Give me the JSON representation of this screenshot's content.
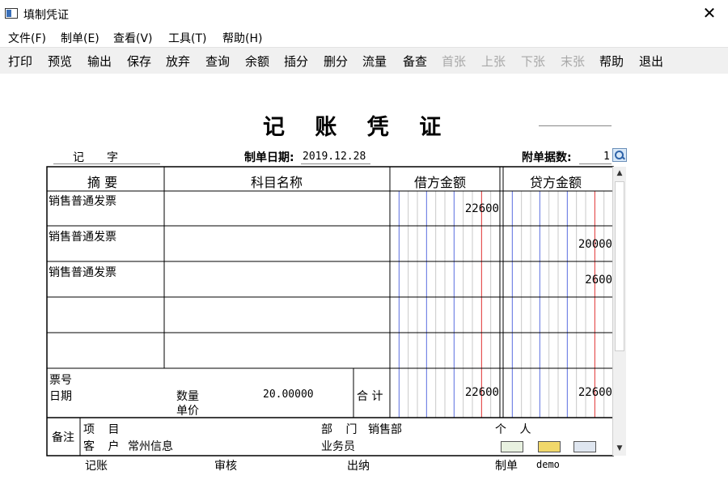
{
  "window": {
    "title": "填制凭证"
  },
  "menu": [
    "文件(F)",
    "制单(E)",
    "查看(V)",
    "工具(T)",
    "帮助(H)"
  ],
  "toolbar": {
    "buttons": [
      {
        "label": "打印",
        "enabled": true
      },
      {
        "label": "预览",
        "enabled": true
      },
      {
        "label": "输出",
        "enabled": true
      },
      {
        "label": "保存",
        "enabled": true
      },
      {
        "label": "放弃",
        "enabled": true
      },
      {
        "label": "查询",
        "enabled": true
      },
      {
        "label": "余额",
        "enabled": true
      },
      {
        "label": "插分",
        "enabled": true
      },
      {
        "label": "删分",
        "enabled": true
      },
      {
        "label": "流量",
        "enabled": true
      },
      {
        "label": "备查",
        "enabled": true
      },
      {
        "label": "首张",
        "enabled": false
      },
      {
        "label": "上张",
        "enabled": false
      },
      {
        "label": "下张",
        "enabled": false
      },
      {
        "label": "末张",
        "enabled": false
      },
      {
        "label": "帮助",
        "enabled": true
      },
      {
        "label": "退出",
        "enabled": true
      }
    ]
  },
  "voucher": {
    "title": "记 账 凭 证",
    "type_label": "记",
    "type_suffix": "字",
    "date_label": "制单日期:",
    "date_value": "2019.12.28",
    "attach_label": "附单据数:",
    "attach_value": "1",
    "columns": {
      "summary": "摘 要",
      "account": "科目名称",
      "debit": "借方金额",
      "credit": "贷方金额"
    },
    "rows": [
      {
        "summary": "销售普通发票",
        "account": "",
        "debit": "22600",
        "credit": ""
      },
      {
        "summary": "销售普通发票",
        "account": "",
        "debit": "",
        "credit": "20000"
      },
      {
        "summary": "销售普通发票",
        "account": "",
        "debit": "",
        "credit": "2600"
      },
      {
        "summary": "",
        "account": "",
        "debit": "",
        "credit": ""
      },
      {
        "summary": "",
        "account": "",
        "debit": "",
        "credit": ""
      }
    ],
    "footer": {
      "ticket_no_label": "票号",
      "date_label": "日期",
      "quantity_label": "数量",
      "quantity_value": "20.00000",
      "unit_price_label": "单价",
      "total_label": "合 计",
      "total_debit": "22600",
      "total_credit": "22600"
    },
    "notes": {
      "label": "备注",
      "project_label": "项 目",
      "department_label": "部 门",
      "department_value": "销售部",
      "person_label": "个 人",
      "customer_label": "客 户",
      "customer_value": "常州信息",
      "salesperson_label": "业务员"
    },
    "signoff": {
      "bookkeeper_label": "记账",
      "auditor_label": "审核",
      "cashier_label": "出纳",
      "maker_label": "制单",
      "maker_value": "demo"
    }
  }
}
